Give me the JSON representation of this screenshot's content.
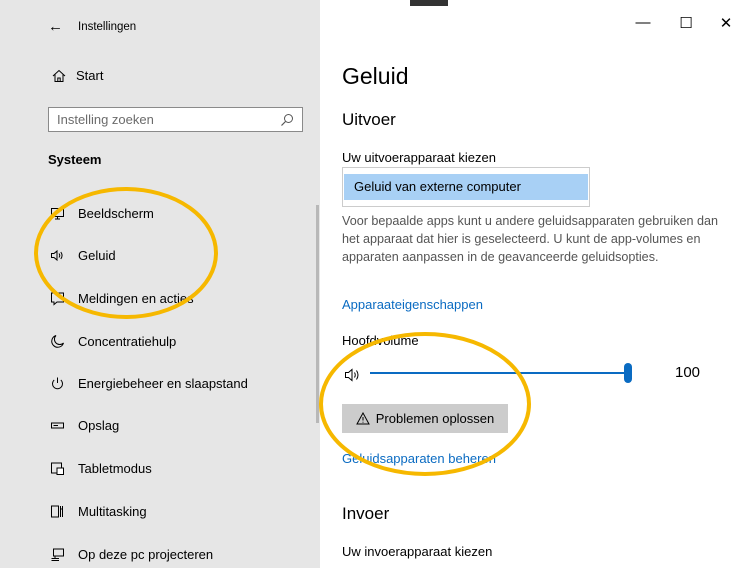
{
  "window": {
    "title": "Instellingen",
    "back_icon": "back-arrow-icon",
    "controls": {
      "minimize": "—",
      "maximize": "☐",
      "close": "✕"
    }
  },
  "sidebar": {
    "home_label": "Start",
    "search": {
      "placeholder": "Instelling zoeken"
    },
    "section_heading": "Systeem",
    "items": [
      {
        "label": "Beeldscherm",
        "icon": "monitor-icon"
      },
      {
        "label": "Geluid",
        "icon": "speaker-icon"
      },
      {
        "label": "Meldingen en acties",
        "icon": "notification-icon"
      },
      {
        "label": "Concentratiehulp",
        "icon": "moon-icon"
      },
      {
        "label": "Energiebeheer en slaapstand",
        "icon": "power-icon"
      },
      {
        "label": "Opslag",
        "icon": "storage-icon"
      },
      {
        "label": "Tabletmodus",
        "icon": "tablet-icon"
      },
      {
        "label": "Multitasking",
        "icon": "multitasking-icon"
      },
      {
        "label": "Op deze pc projecteren",
        "icon": "project-icon"
      }
    ]
  },
  "main": {
    "title": "Geluid",
    "output": {
      "heading": "Uitvoer",
      "choose_label": "Uw uitvoerapparaat kiezen",
      "selected_device": "Geluid van externe computer",
      "description": "Voor bepaalde apps kunt u andere geluidsapparaten gebruiken dan het apparaat dat hier is geselecteerd. U kunt de app-volumes en apparaten aanpassen in de geavanceerde geluidsopties.",
      "device_properties_link": "Apparaateigenschappen",
      "volume_label": "Hoofdvolume",
      "volume_value": "100",
      "volume_level": 1.0,
      "troubleshoot_button": "Problemen oplossen",
      "manage_devices_link": "Geluidsapparaten beheren"
    },
    "input": {
      "heading": "Invoer",
      "choose_label": "Uw invoerapparaat kiezen"
    }
  },
  "colors": {
    "accent": "#0a6bc2",
    "selected_bg": "#a8d0f5",
    "sidebar_bg": "#e6e6e6",
    "annotation": "#f6b800"
  }
}
